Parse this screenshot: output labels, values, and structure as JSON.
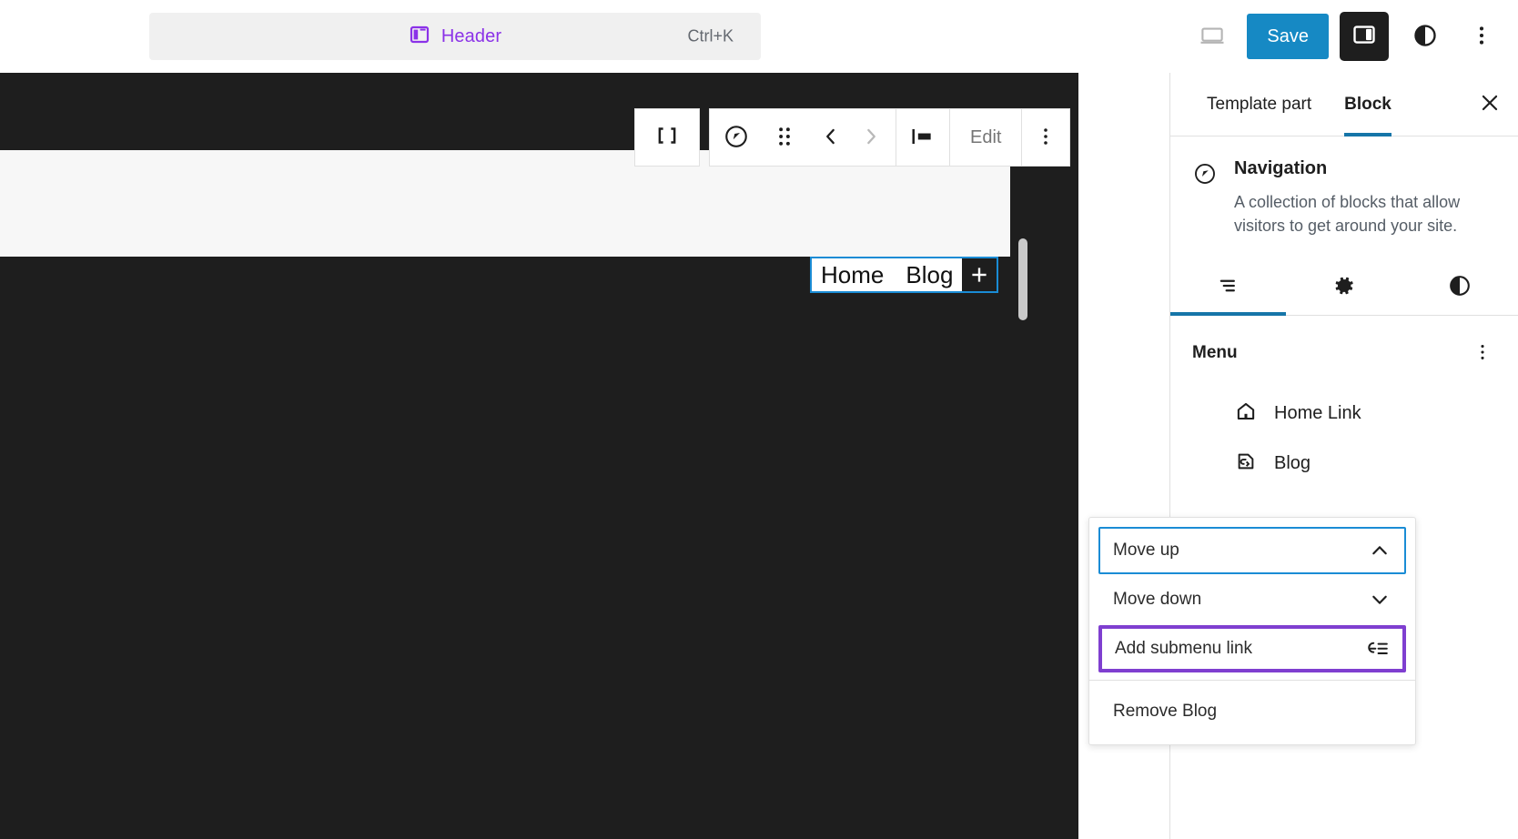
{
  "topbar": {
    "command_label": "Header",
    "command_icon": "template-part-icon",
    "shortcut": "Ctrl+K",
    "device_preview_icon": "desktop-icon",
    "save_label": "Save",
    "sidebar_toggle_icon": "sidebar-panel-icon",
    "styles_icon": "contrast-circle-icon",
    "more_icon": "kebab-vertical-icon",
    "accent_purple": "#8b32e8",
    "save_blue": "#1689c4",
    "dark": "#1e1e1e"
  },
  "toolbar": {
    "select_parent_icon": "select-parent-icon",
    "block_type_icon": "navigation-compass-icon",
    "drag_icon": "drag-handle-dots-icon",
    "move_prev_icon": "chevron-left-icon",
    "move_next_icon": "chevron-right-icon",
    "align_icon": "align-left-icon",
    "edit_label": "Edit",
    "more_icon": "kebab-vertical-icon"
  },
  "canvas": {
    "nav_items": [
      "Home",
      "Blog"
    ],
    "appender_label": "+",
    "selection_color": "#1a8cd5"
  },
  "sidebar": {
    "tabs": [
      {
        "label": "Template part",
        "active": false
      },
      {
        "label": "Block",
        "active": true
      }
    ],
    "close_icon": "close-x-icon",
    "block": {
      "icon": "navigation-compass-icon",
      "title": "Navigation",
      "description": "A collection of blocks that allow visitors to get around your site."
    },
    "inspector_tabs": [
      {
        "icon": "list-view-icon",
        "active": true
      },
      {
        "icon": "gear-icon",
        "active": false
      },
      {
        "icon": "contrast-circle-icon",
        "active": false
      }
    ],
    "menu": {
      "title": "Menu",
      "more_icon": "kebab-vertical-icon",
      "items": [
        {
          "label": "Home Link",
          "icon": "home-icon"
        },
        {
          "label": "Blog",
          "icon": "page-link-icon"
        }
      ]
    }
  },
  "popover": {
    "items": [
      {
        "label": "Move up",
        "icon": "chevron-up-icon",
        "state": "focused"
      },
      {
        "label": "Move down",
        "icon": "chevron-down-icon",
        "state": "normal"
      },
      {
        "label": "Add submenu link",
        "icon": "submenu-indent-icon",
        "state": "highlighted"
      },
      {
        "label": "Remove Blog",
        "icon": "",
        "state": "normal"
      }
    ],
    "focus_color": "#1a8cd5",
    "highlight_color": "#7f3fd0"
  }
}
